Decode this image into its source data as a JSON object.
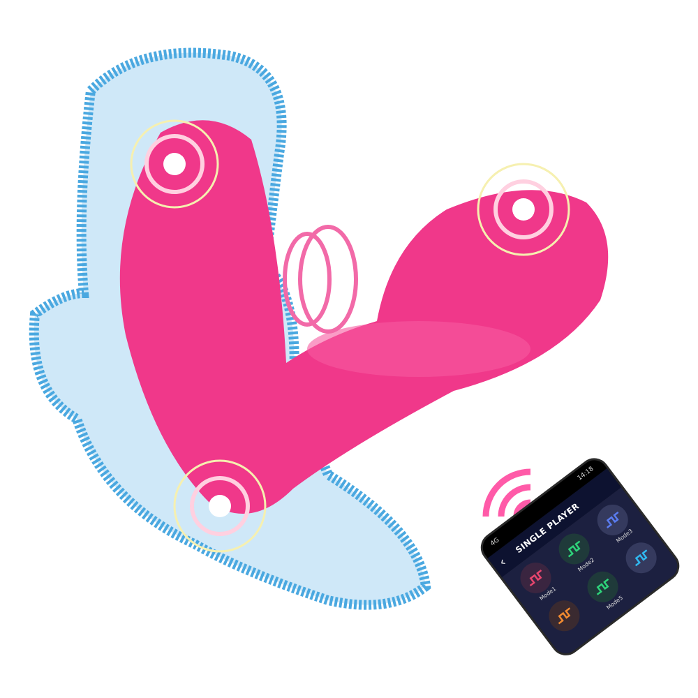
{
  "phone": {
    "status_left": "4G",
    "time": "14:18",
    "title": "SINGLE PLAYER",
    "modes": [
      {
        "label": "Mode1",
        "color": "#e8466e",
        "bg": "#3a2540"
      },
      {
        "label": "Mode2",
        "color": "#2ed37a",
        "bg": "#1f3a3a"
      },
      {
        "label": "Mode3",
        "color": "#5a7cf0",
        "bg": "#353a5e"
      },
      {
        "label": "",
        "color": "#f08a30",
        "bg": "#3a2a30"
      },
      {
        "label": "Mode5",
        "color": "#2ed37a",
        "bg": "#1f3a3a"
      },
      {
        "label": "",
        "color": "#30b8f0",
        "bg": "#353a5e"
      }
    ]
  },
  "colors": {
    "product": "#f0388a",
    "pad": "#4aa8e0",
    "signal": "#ff5aa8"
  }
}
